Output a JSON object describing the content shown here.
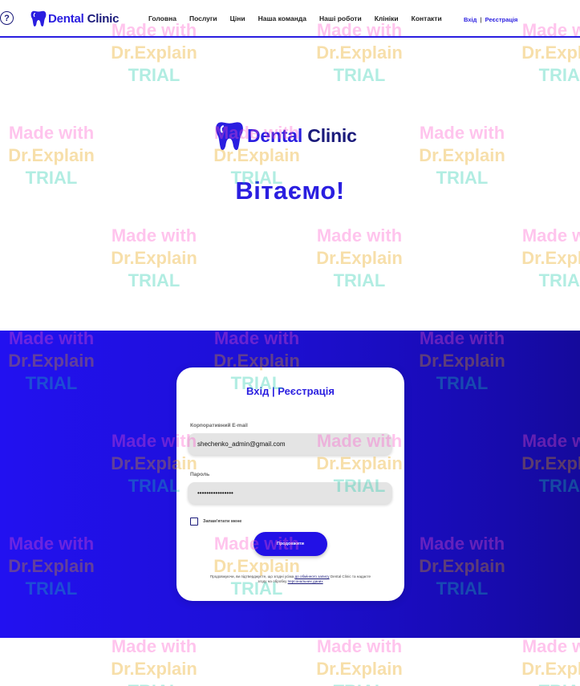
{
  "header": {
    "help_icon_glyph": "?",
    "logo": {
      "word1": "Dental",
      "word2": "Clinic"
    },
    "nav": [
      {
        "label": "Головна"
      },
      {
        "label": "Послуги"
      },
      {
        "label": "Ціни"
      },
      {
        "label": "Наша команда"
      },
      {
        "label": "Наші роботи"
      },
      {
        "label": "Клініки"
      },
      {
        "label": "Контакти"
      }
    ],
    "auth": {
      "login": "Вхід",
      "separator": "|",
      "register": "Реєстрація"
    }
  },
  "hero": {
    "logo": {
      "word1": "Dental",
      "word2": "Clinic"
    },
    "welcome": "Вітаємо!"
  },
  "login_card": {
    "title": "Вхід | Реєстрація",
    "email_label": "Корпоративний E-mail",
    "email_value": "shechenko_admin@gmail.com",
    "password_label": "Пароль",
    "password_value": "••••••••••••••••",
    "remember_label": "Запам'ятати мене",
    "continue_label": "Продовжити",
    "terms": {
      "prefix": "Продовжуючи, ви підтверджуєте, що згодні усіма",
      "link1": "до обмінного запису",
      "middle": "Dental Clinic та надаєте згоду на обробку",
      "link2": "персональних даних"
    }
  },
  "watermark": {
    "line1": "Made with",
    "line2": "Dr.Explain",
    "line3": "TRIAL"
  },
  "colors": {
    "brand_blue": "#2a1ee0",
    "brand_dark": "#1a1a7a",
    "band_start": "#2211f0",
    "band_end": "#150a9c"
  },
  "icons": {
    "help": "question-circle-icon",
    "logo": "tooth-icon",
    "checkbox": "checkbox-icon"
  }
}
